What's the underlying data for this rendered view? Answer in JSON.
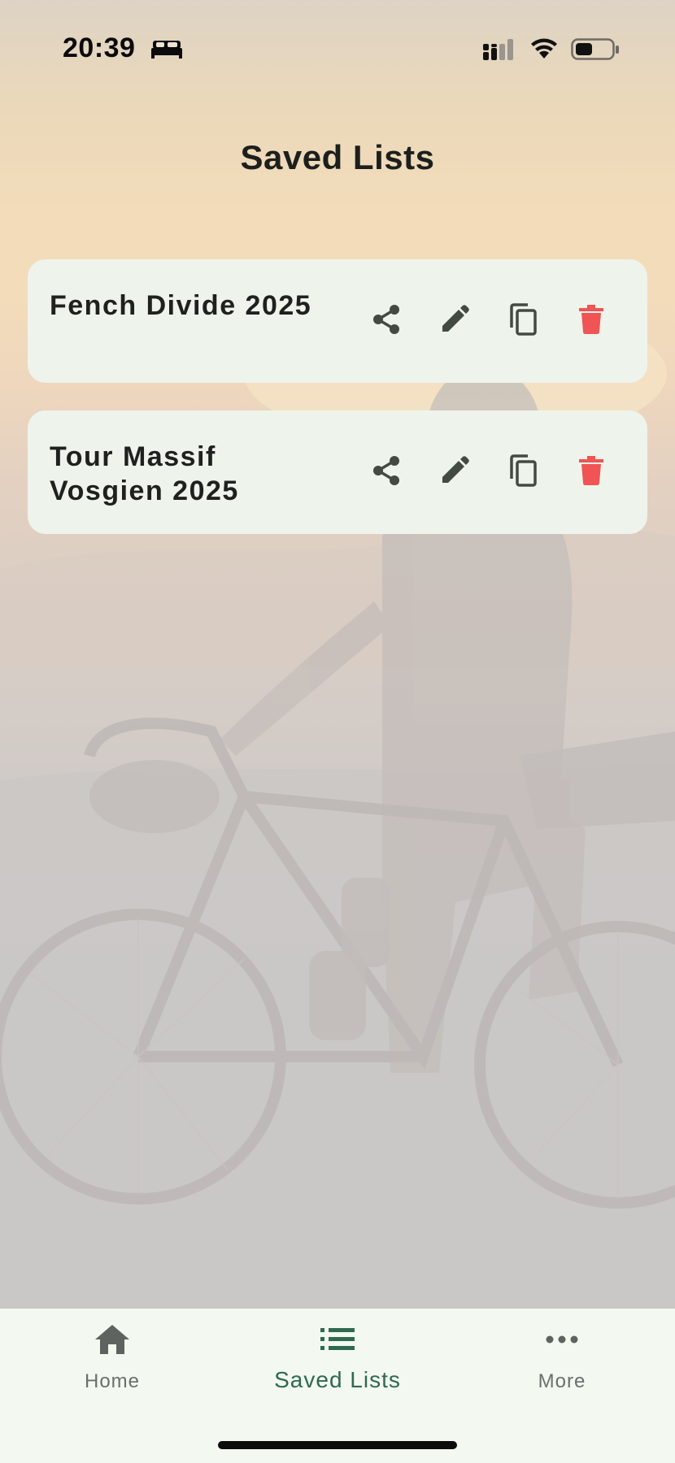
{
  "status_bar": {
    "time": "20:39",
    "sleep_icon": "bed-icon",
    "signal_icon": "cellular-signal-icon",
    "wifi_icon": "wifi-icon",
    "battery_icon": "battery-icon"
  },
  "page": {
    "title": "Saved Lists"
  },
  "lists": [
    {
      "name": "Fench Divide 2025",
      "actions": [
        "share-icon",
        "edit-icon",
        "copy-icon",
        "delete-icon"
      ]
    },
    {
      "name": "Tour Massif Vosgien 2025",
      "actions": [
        "share-icon",
        "edit-icon",
        "copy-icon",
        "delete-icon"
      ]
    }
  ],
  "bottom_nav": {
    "items": [
      {
        "label": "Home",
        "icon": "home-icon",
        "active": false
      },
      {
        "label": "Saved Lists",
        "icon": "list-icon",
        "active": true
      },
      {
        "label": "More",
        "icon": "more-horizontal-icon",
        "active": false
      }
    ]
  },
  "colors": {
    "card_background": "#eef3ec",
    "icon_default": "#424a42",
    "delete_red": "#f05454",
    "nav_active": "#2e6a4f",
    "nav_inactive": "#6b6f6b",
    "nav_background": "#f3f8f1"
  }
}
